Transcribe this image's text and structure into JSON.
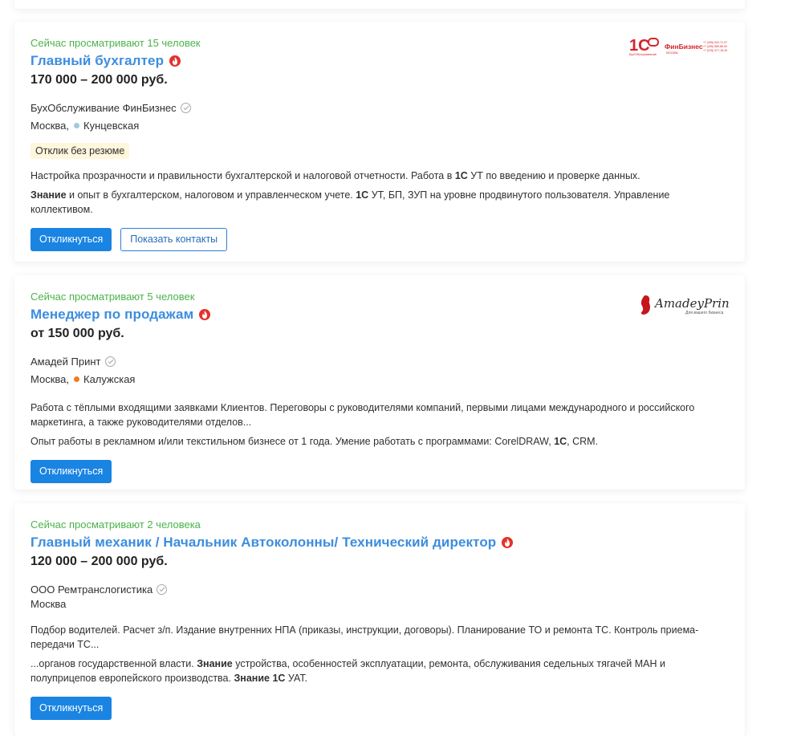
{
  "vacancies": [
    {
      "viewers": "Сейчас просматривают 15 человек",
      "title": "Главный бухгалтер",
      "salary": "170 000 – 200 000 руб.",
      "company": "БухОбслуживание ФинБизнес",
      "city": "Москва,",
      "metro": "Кунцевская",
      "metro_color": "#9fcbd9",
      "badge": "Отклик без резюме",
      "desc1_a": "Настройка прозрачности и правильности бухгалтерской и налоговой отчетности. Работа в ",
      "desc1_b": "1С",
      "desc1_c": " УТ по введению и проверке данных.",
      "desc2_a": "Знание",
      "desc2_b": " и опыт в бухгалтерском, налоговом и управленческом учете. ",
      "desc2_c": "1С",
      "desc2_d": " УТ, БП, ЗУП на уровне продвинутого пользователя. Управление коллективом.",
      "respond": "Откликнуться",
      "contacts": "Показать контакты",
      "logo_text1": "1С",
      "logo_text2": "ФинБизнес"
    },
    {
      "viewers": "Сейчас просматривают 5 человек",
      "title": "Менеджер по продажам",
      "salary": "от 150 000 руб.",
      "company": "Амадей Принт",
      "city": "Москва,",
      "metro": "Калужская",
      "metro_color": "#f07b25",
      "desc1_a": "Работа с тёплыми входящими заявками Клиентов. Переговоры с руководителями компаний, первыми лицами международного и российского маркетинга, а также руководителями отделов...",
      "desc2_a": "Опыт работы в рекламном и/или текстильном бизнесе от 1 года. Умение работать с программами: CorelDRAW, ",
      "desc2_b": "1С",
      "desc2_c": ", CRM.",
      "respond": "Откликнуться",
      "logo_text": "AmadeyPrint",
      "logo_sub": "Для вашего бизнеса"
    },
    {
      "viewers": "Сейчас просматривают 2 человека",
      "title": "Главный механик / Начальник Автоколонны/ Технический директор",
      "salary": "120 000 – 200 000 руб.",
      "company": "ООО Ремтранслогистика",
      "city": "Москва",
      "desc1_a": "Подбор водителей. Расчет з/п. Издание внутренних НПА (приказы, инструкции, договоры). Планирование ТО и ремонта ТС. Контроль приема-передачи ТС...",
      "desc2_a": "...органов государственной власти. ",
      "desc2_b": "Знание",
      "desc2_c": " устройства, особенностей эксплуатации, ремонта, обслуживания седельных тягачей МАН и полуприцепов европейского производства. ",
      "desc2_d": "Знание 1С",
      "desc2_e": " УАТ.",
      "respond": "Откликнуться"
    }
  ],
  "colors": {
    "accent": "#1a84e3",
    "title": "#3c8dde",
    "viewers": "#4bb34b",
    "fire": "#e4322b"
  },
  "icons": [
    "fire-icon",
    "verified-check-icon",
    "metro-dot-icon"
  ]
}
